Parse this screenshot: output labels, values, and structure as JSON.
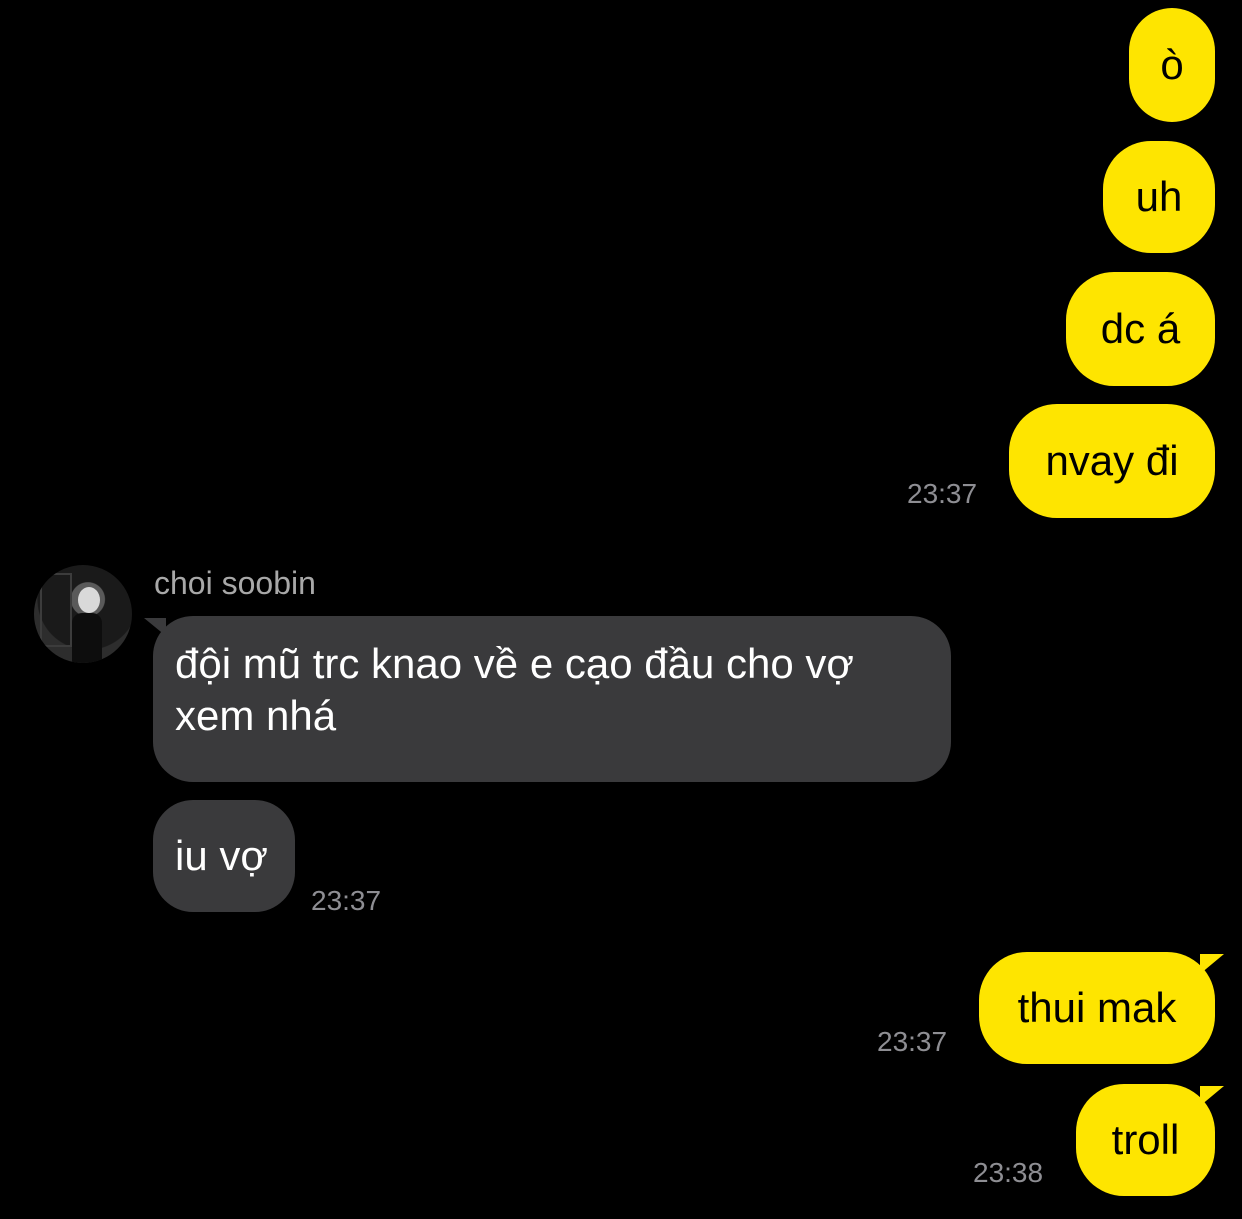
{
  "colors": {
    "background": "#000000",
    "my_bubble": "#FEE500",
    "their_bubble": "#3A3A3C",
    "timestamp": "#8E8E93",
    "sender_name": "#A8A8A8"
  },
  "contact": {
    "name": "choi soobin",
    "avatar_icon": "avatar-photo"
  },
  "messages": [
    {
      "sender": "me",
      "text": "ò"
    },
    {
      "sender": "me",
      "text": "uh"
    },
    {
      "sender": "me",
      "text": "dc á"
    },
    {
      "sender": "me",
      "text": "nvay đi",
      "time": "23:37"
    },
    {
      "sender": "them",
      "text": "đội mũ trc knao về e cạo đầu cho vợ xem nhá"
    },
    {
      "sender": "them",
      "text": "iu vợ",
      "time": "23:37"
    },
    {
      "sender": "me",
      "text": "thui mak",
      "time": "23:37"
    },
    {
      "sender": "me",
      "text": "troll",
      "time": "23:38"
    }
  ]
}
